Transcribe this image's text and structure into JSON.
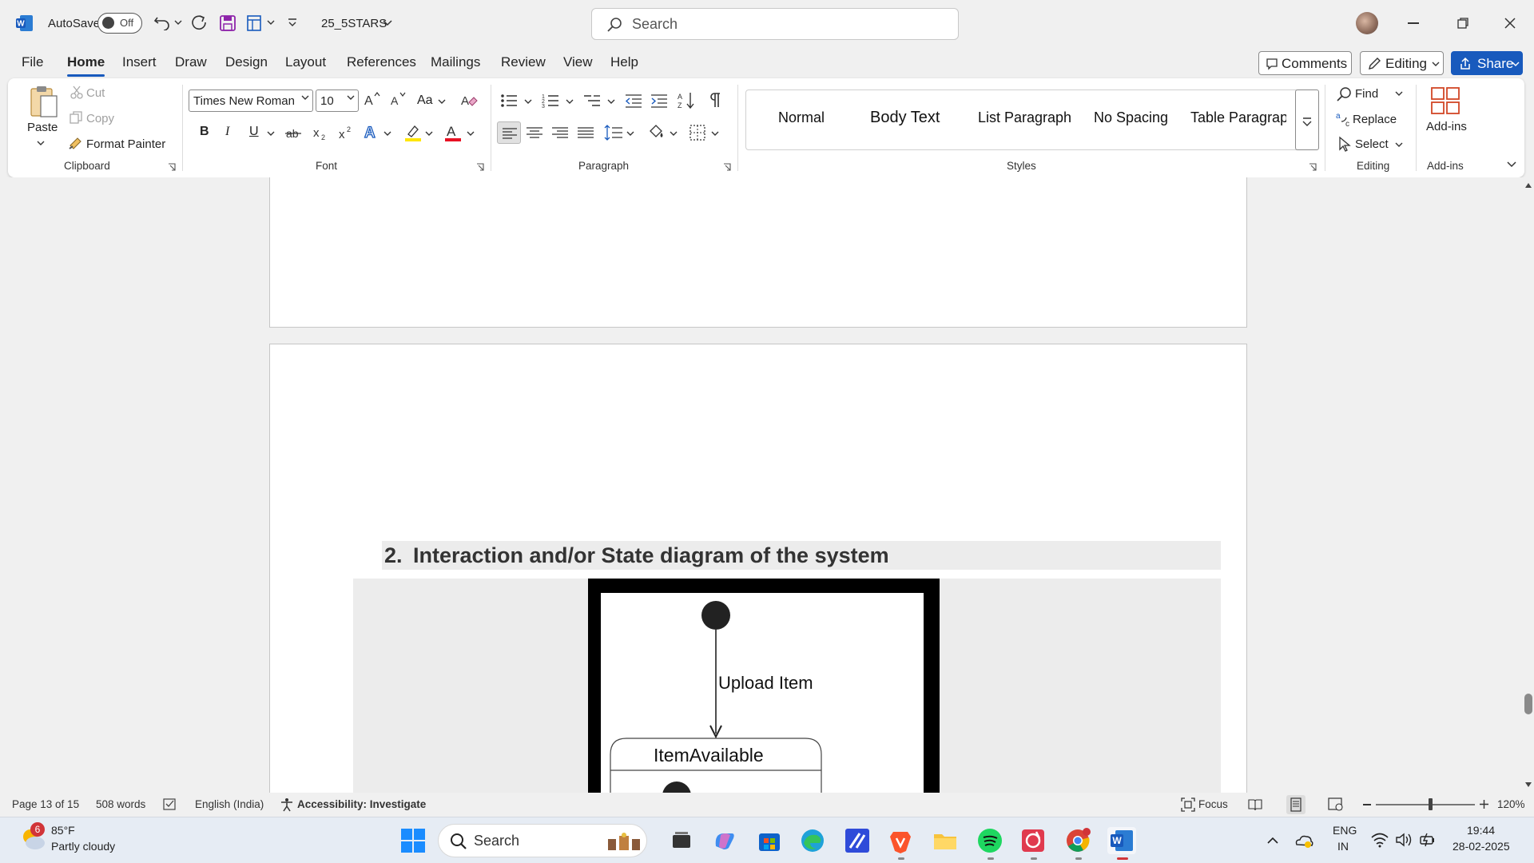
{
  "titlebar": {
    "autosave_label": "AutoSave",
    "autosave_state": "Off",
    "doc_name": "25_5STARS",
    "search_placeholder": "Search"
  },
  "menu": {
    "items": [
      "File",
      "Home",
      "Insert",
      "Draw",
      "Design",
      "Layout",
      "References",
      "Mailings",
      "Review",
      "View",
      "Help"
    ],
    "active": "Home",
    "comments_label": "Comments",
    "editing_label": "Editing",
    "share_label": "Share"
  },
  "ribbon": {
    "clipboard": {
      "paste": "Paste",
      "cut": "Cut",
      "copy": "Copy",
      "format_painter": "Format Painter",
      "group": "Clipboard"
    },
    "font": {
      "name": "Times New Roman",
      "size": "10",
      "group": "Font",
      "bold": "B",
      "italic": "I",
      "underline": "U",
      "case_label": "Aa"
    },
    "paragraph": {
      "group": "Paragraph"
    },
    "styles": {
      "items": [
        "Normal",
        "Body Text",
        "List Paragraph",
        "No Spacing",
        "Table Paragrap"
      ],
      "group": "Styles"
    },
    "editing": {
      "find": "Find",
      "replace": "Replace",
      "select": "Select",
      "group": "Editing"
    },
    "addins": {
      "label": "Add-ins",
      "group": "Add-ins"
    }
  },
  "document": {
    "heading_number": "2.",
    "heading_text": "Interaction and/or State diagram of the system",
    "diagram": {
      "transition_label": "Upload Item",
      "state_name": "ItemAvailable"
    }
  },
  "statusbar": {
    "page": "Page 13 of 15",
    "words": "508 words",
    "language": "English (India)",
    "accessibility": "Accessibility: Investigate",
    "focus": "Focus",
    "zoom": "120%",
    "zoom_level": 0.55
  },
  "taskbar": {
    "weather_temp": "85°F",
    "weather_desc": "Partly cloudy",
    "weather_badge": "6",
    "search_label": "Search",
    "lang_top": "ENG",
    "lang_bottom": "IN",
    "time": "19:44",
    "date": "28-02-2025"
  },
  "colors": {
    "accent": "#185abd",
    "word_blue": "#185abd",
    "highlight": "#ffe600",
    "font_color": "#e81123"
  }
}
